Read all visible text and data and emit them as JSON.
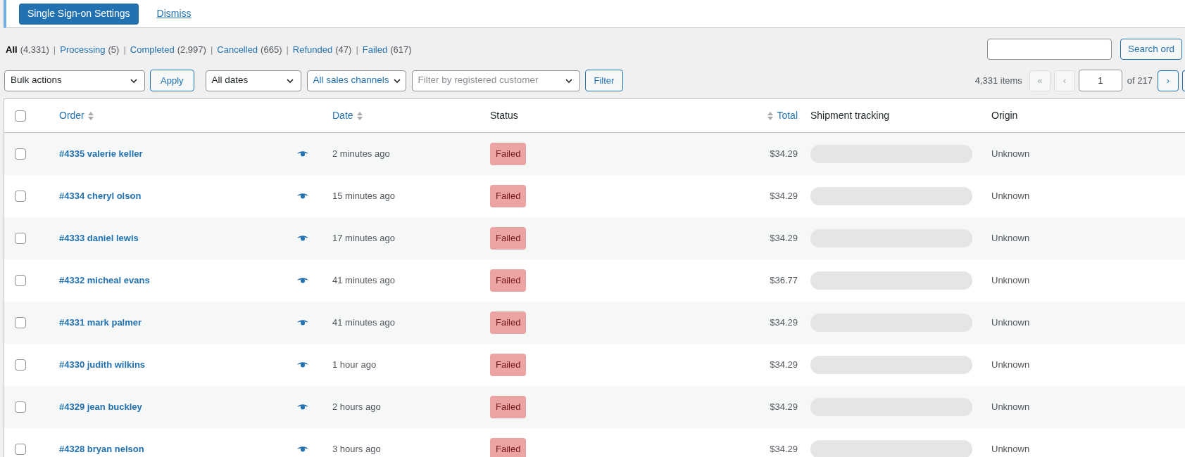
{
  "notice": {
    "button": "Single Sign-on Settings",
    "dismiss": "Dismiss"
  },
  "status_links": [
    {
      "label": "All",
      "count": "(4,331)",
      "selected": true
    },
    {
      "separator": "|",
      "label": "Processing",
      "count": "(5)",
      "selected": false
    },
    {
      "separator": "|",
      "label": "Completed",
      "count": "(2,997)",
      "selected": false
    },
    {
      "separator": "|",
      "label": "Cancelled",
      "count": "(665)",
      "selected": false
    },
    {
      "separator": "|",
      "label": "Refunded",
      "count": "(47)",
      "selected": false
    },
    {
      "separator": "|",
      "label": "Failed",
      "count": "(617)",
      "selected": false
    }
  ],
  "search": {
    "button": "Search ord"
  },
  "filters": {
    "bulk_actions": "Bulk actions",
    "apply": "Apply",
    "dates": "All dates",
    "channels": "All sales channels",
    "customer_placeholder": "Filter by registered customer",
    "filter": "Filter"
  },
  "pagination": {
    "items": "4,331 items",
    "first": "«",
    "prev": "‹",
    "page": "1",
    "of": "of 217",
    "next": "›"
  },
  "table": {
    "select_all_checked": false,
    "columns": [
      {
        "label": "Order",
        "sortable": true
      },
      {
        "label": "Date",
        "sortable": true
      },
      {
        "label": "Status",
        "sortable": false
      },
      {
        "label": "Total",
        "sortable": true
      },
      {
        "label": "Shipment tracking",
        "sortable": false
      },
      {
        "label": "Origin",
        "sortable": false
      }
    ],
    "rows": [
      {
        "checked": false,
        "order": "#4335 valerie keller",
        "date": "2 minutes ago",
        "status": "Failed",
        "total": "$34.29",
        "origin": "Unknown"
      },
      {
        "checked": false,
        "order": "#4334 cheryl olson",
        "date": "15 minutes ago",
        "status": "Failed",
        "total": "$34.29",
        "origin": "Unknown"
      },
      {
        "checked": false,
        "order": "#4333 daniel lewis",
        "date": "17 minutes ago",
        "status": "Failed",
        "total": "$34.29",
        "origin": "Unknown"
      },
      {
        "checked": false,
        "order": "#4332 micheal evans",
        "date": "41 minutes ago",
        "status": "Failed",
        "total": "$36.77",
        "origin": "Unknown"
      },
      {
        "checked": false,
        "order": "#4331 mark palmer",
        "date": "41 minutes ago",
        "status": "Failed",
        "total": "$34.29",
        "origin": "Unknown"
      },
      {
        "checked": false,
        "order": "#4330 judith wilkins",
        "date": "1 hour ago",
        "status": "Failed",
        "total": "$34.29",
        "origin": "Unknown"
      },
      {
        "checked": false,
        "order": "#4329 jean buckley",
        "date": "2 hours ago",
        "status": "Failed",
        "total": "$34.29",
        "origin": "Unknown"
      },
      {
        "checked": false,
        "order": "#4328 bryan nelson",
        "date": "3 hours ago",
        "status": "Failed",
        "total": "$34.29",
        "origin": "Unknown"
      }
    ]
  }
}
